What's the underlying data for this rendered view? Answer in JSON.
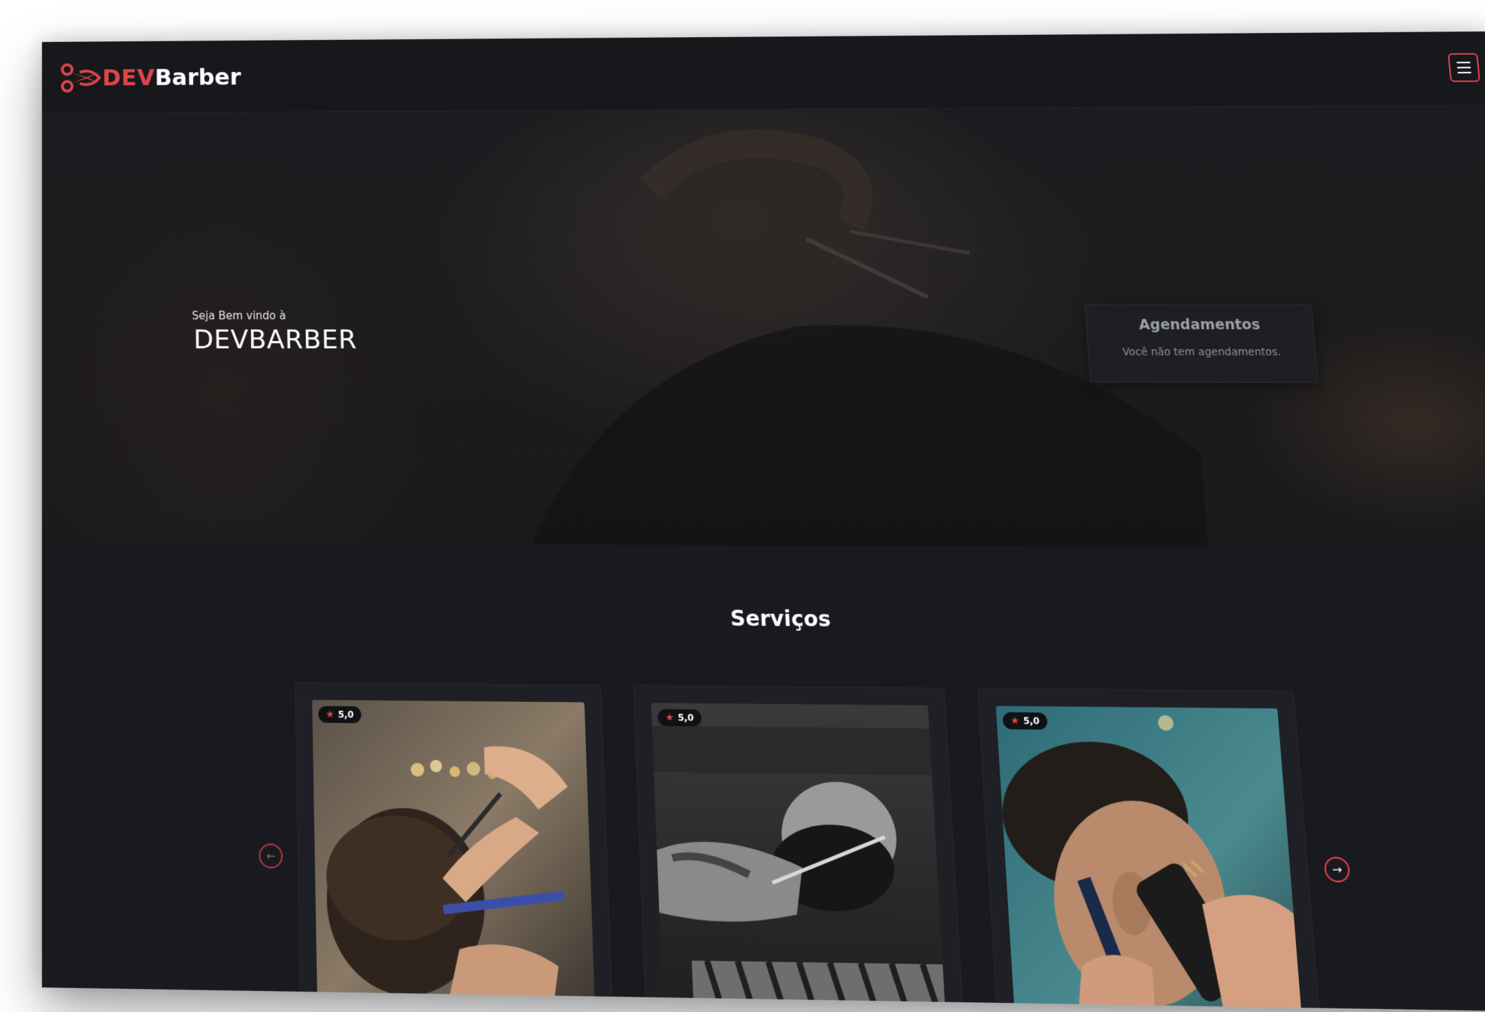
{
  "header": {
    "logo_dev": "DEV",
    "logo_barber": "Barber",
    "menu_icon": "hamburger-menu-icon"
  },
  "hero": {
    "welcome_small": "Seja Bem vindo à",
    "welcome_title": "DEVBARBER",
    "appointments": {
      "title": "Agendamentos",
      "empty_text": "Você não tem agendamentos."
    }
  },
  "services": {
    "title": "Serviços",
    "cards": [
      {
        "rating": "5,0"
      },
      {
        "rating": "5,0"
      },
      {
        "rating": "5,0"
      }
    ],
    "prev_icon": "arrow-left-icon",
    "next_icon": "arrow-right-icon"
  },
  "colors": {
    "accent": "#e0454b",
    "background": "#181a1f",
    "header_bg": "#16181c"
  }
}
